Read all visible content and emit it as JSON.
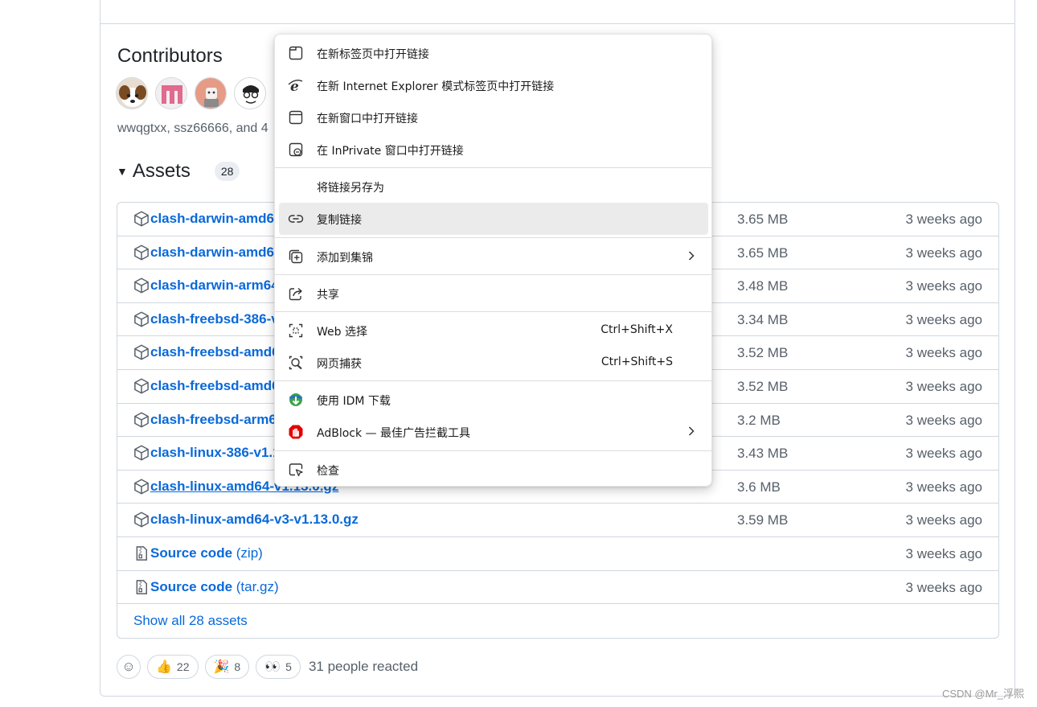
{
  "contributors": {
    "title": "Contributors",
    "names": "wwqgtxx, ssz66666, and 4"
  },
  "assets": {
    "title": "Assets",
    "count": "28",
    "rows": [
      {
        "name": "clash-darwin-amd6",
        "ext": "",
        "size": "3.65 MB",
        "time": "3 weeks ago",
        "icon": "package-icon"
      },
      {
        "name": "clash-darwin-amd6",
        "ext": "",
        "size": "3.65 MB",
        "time": "3 weeks ago",
        "icon": "package-icon"
      },
      {
        "name": "clash-darwin-arm64",
        "ext": "",
        "size": "3.48 MB",
        "time": "3 weeks ago",
        "icon": "package-icon"
      },
      {
        "name": "clash-freebsd-386-v",
        "ext": "",
        "size": "3.34 MB",
        "time": "3 weeks ago",
        "icon": "package-icon"
      },
      {
        "name": "clash-freebsd-amd6",
        "ext": "",
        "size": "3.52 MB",
        "time": "3 weeks ago",
        "icon": "package-icon"
      },
      {
        "name": "clash-freebsd-amd6",
        "ext": "",
        "size": "3.52 MB",
        "time": "3 weeks ago",
        "icon": "package-icon"
      },
      {
        "name": "clash-freebsd-arm6",
        "ext": "",
        "size": "3.2 MB",
        "time": "3 weeks ago",
        "icon": "package-icon"
      },
      {
        "name": "clash-linux-386-v1.1",
        "ext": "",
        "size": "3.43 MB",
        "time": "3 weeks ago",
        "icon": "package-icon"
      },
      {
        "name": "clash-linux-amd64-v1.13.0.gz",
        "ext": "",
        "size": "3.6 MB",
        "time": "3 weeks ago",
        "icon": "package-icon"
      },
      {
        "name": "clash-linux-amd64-v3-v1.13.0.gz",
        "ext": "",
        "size": "3.59 MB",
        "time": "3 weeks ago",
        "icon": "package-icon"
      },
      {
        "name": "Source code",
        "ext": " (zip)",
        "size": "",
        "time": "3 weeks ago",
        "icon": "file-zip-icon"
      },
      {
        "name": "Source code",
        "ext": " (tar.gz)",
        "size": "",
        "time": "3 weeks ago",
        "icon": "file-zip-icon"
      }
    ],
    "show_all": "Show all 28 assets"
  },
  "reactions": {
    "thumbs_up": "22",
    "tada": "8",
    "eyes": "5",
    "summary": "31 people reacted"
  },
  "context_menu": {
    "items": [
      {
        "label": "在新标签页中打开链接",
        "icon": "new-tab-icon"
      },
      {
        "label": "在新 Internet Explorer 模式标签页中打开链接",
        "icon": "internet-explorer-icon"
      },
      {
        "label": "在新窗口中打开链接",
        "icon": "new-window-icon"
      },
      {
        "label": "在 InPrivate 窗口中打开链接",
        "icon": "inprivate-icon"
      },
      {
        "label": "将链接另存为",
        "icon": ""
      },
      {
        "label": "复制链接",
        "icon": "link-icon"
      },
      {
        "label": "添加到集锦",
        "icon": "collections-icon"
      },
      {
        "label": "共享",
        "icon": "share-icon"
      },
      {
        "label": "Web 选择",
        "icon": "web-select-icon",
        "shortcut": "Ctrl+Shift+X"
      },
      {
        "label": "网页捕获",
        "icon": "web-capture-icon",
        "shortcut": "Ctrl+Shift+S"
      },
      {
        "label": "使用 IDM 下载",
        "icon": "idm-icon"
      },
      {
        "label": "AdBlock — 最佳广告拦截工具",
        "icon": "adblock-icon"
      },
      {
        "label": "检查",
        "icon": "inspect-icon"
      }
    ]
  },
  "watermark": "CSDN @Mr_浮熙",
  "colors": {
    "link": "#0969da",
    "muted": "#57606a",
    "border": "#d0d7de",
    "menu_hover": "#ebebeb",
    "adblock_red": "#e40000"
  }
}
